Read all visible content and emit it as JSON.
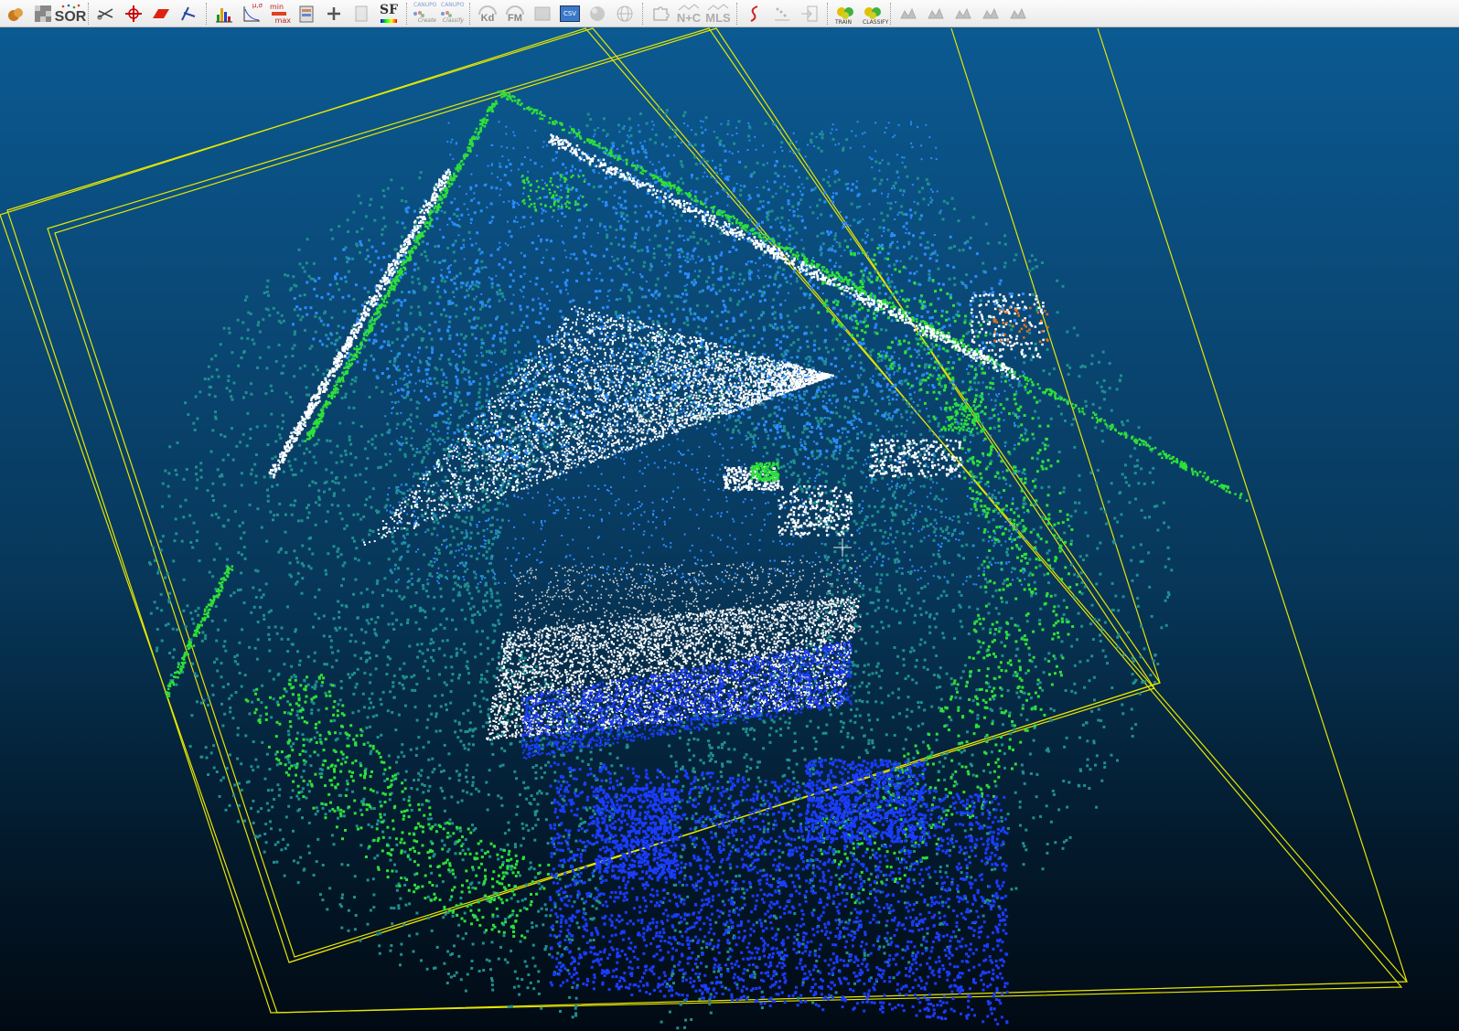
{
  "toolbar": {
    "groups": [
      [
        {
          "name": "cloud-sample-icon",
          "label": ""
        },
        {
          "name": "noise-filter-icon",
          "label": ""
        },
        {
          "name": "sor-filter-button",
          "label": "SOR"
        }
      ],
      [
        {
          "name": "scissors-icon",
          "label": ""
        },
        {
          "name": "transform-icon",
          "label": ""
        },
        {
          "name": "plane-icon",
          "label": ""
        },
        {
          "name": "segment-icon",
          "label": ""
        }
      ],
      [
        {
          "name": "histogram-icon",
          "label": ""
        },
        {
          "name": "stat-fit-icon",
          "label": ""
        },
        {
          "name": "minmax-icon",
          "label": ""
        },
        {
          "name": "sf-table-icon",
          "label": ""
        },
        {
          "name": "plus-icon",
          "label": ""
        },
        {
          "name": "calculator-icon",
          "label": ""
        },
        {
          "name": "sf-colorscale-button",
          "label": "SF"
        }
      ],
      [
        {
          "name": "canupo-create-button",
          "label": "Create"
        },
        {
          "name": "canupo-classify-button",
          "label": "Classify"
        }
      ],
      [
        {
          "name": "kd-tree-button",
          "label": "Kd"
        },
        {
          "name": "fast-marching-button",
          "label": "FM"
        },
        {
          "name": "file-io-icon",
          "label": ""
        },
        {
          "name": "csv-export-button",
          "label": "CSV"
        },
        {
          "name": "sphere-icon",
          "label": ""
        },
        {
          "name": "globe-icon",
          "label": ""
        }
      ],
      [
        {
          "name": "puzzle-icon",
          "label": ""
        },
        {
          "name": "n-plus-c-button",
          "label": "N+C"
        },
        {
          "name": "mls-button",
          "label": "MLS"
        }
      ],
      [
        {
          "name": "spline-icon",
          "label": ""
        },
        {
          "name": "cloud-layers-icon",
          "label": ""
        },
        {
          "name": "export-icon",
          "label": ""
        }
      ],
      [
        {
          "name": "train-classifier-button",
          "label": "TRAIN"
        },
        {
          "name": "classify-cloud-button",
          "label": "CLASSIFY"
        }
      ],
      [
        {
          "name": "view-front-icon",
          "label": ""
        },
        {
          "name": "view-back-icon",
          "label": ""
        },
        {
          "name": "view-left-icon",
          "label": ""
        },
        {
          "name": "view-right-icon",
          "label": ""
        },
        {
          "name": "view-bottom-icon",
          "label": ""
        }
      ]
    ],
    "canupo_caption": "CANUPO",
    "minmax_top": "min",
    "minmax_bottom": "max",
    "mu_sigma": "μ,σ"
  },
  "viewport": {
    "background_top": "#0b5a92",
    "background_bottom": "#010a13",
    "bbox_color": "#e6e600",
    "point_colors": [
      "#ffffff",
      "#1a3cff",
      "#2a8cff",
      "#1f8f8f",
      "#2ee03a",
      "#38b000"
    ]
  }
}
